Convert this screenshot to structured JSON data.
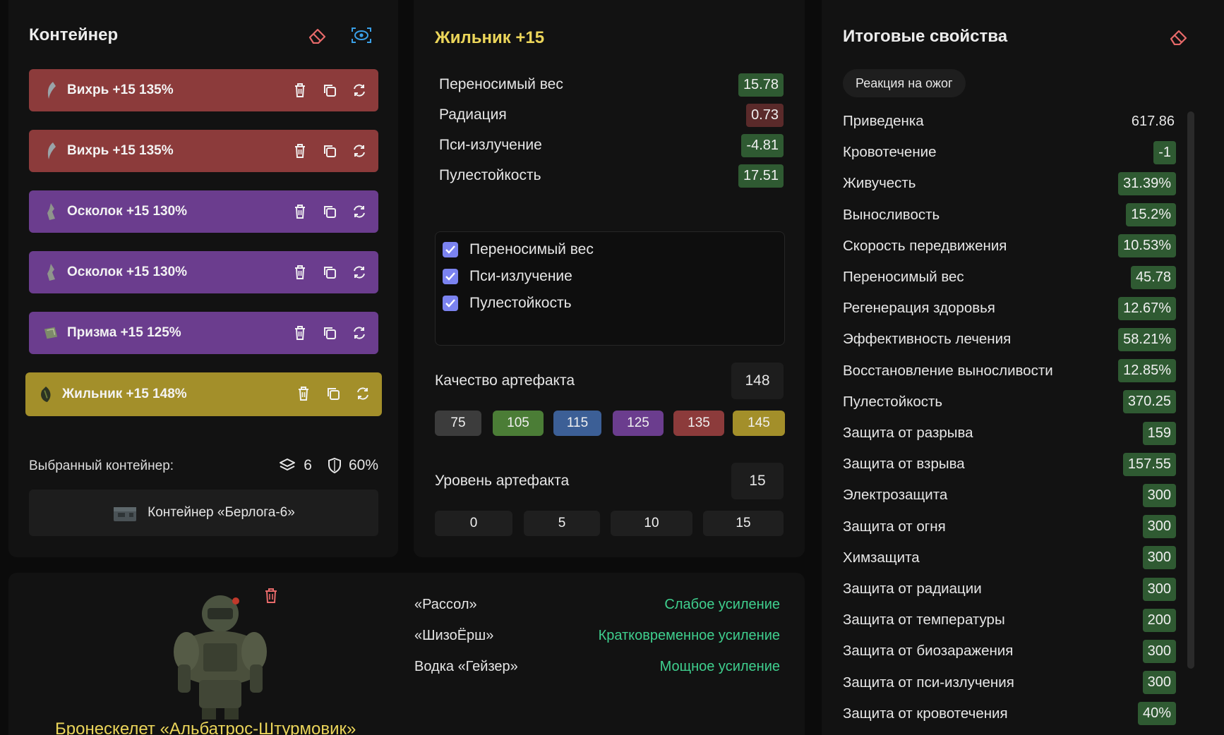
{
  "container_panel": {
    "title": "Контейнер",
    "artifacts": [
      {
        "name": "Вихрь  +15 135%",
        "color": "#8c3b3b"
      },
      {
        "name": "Вихрь  +15 135%",
        "color": "#8c3b3b"
      },
      {
        "name": "Осколок  +15 130%",
        "color": "#6b3d8e"
      },
      {
        "name": "Осколок  +15 130%",
        "color": "#6b3d8e"
      },
      {
        "name": "Призма  +15 125%",
        "color": "#6b3d8e"
      },
      {
        "name": "Жильник  +15 148%",
        "color": "#a38f2a"
      }
    ],
    "selected_label": "Выбранный контейнер:",
    "slots": "6",
    "protection": "60%",
    "container_name": "Контейнер «Берлога-6»"
  },
  "artifact_panel": {
    "title": "Жильник +15",
    "properties": [
      {
        "name": "Переносимый вес",
        "value": "15.78",
        "tone": "good"
      },
      {
        "name": "Радиация",
        "value": "0.73",
        "tone": "bad"
      },
      {
        "name": "Пси-излучение",
        "value": "-4.81",
        "tone": "good"
      },
      {
        "name": "Пулестойкость",
        "value": "17.51",
        "tone": "good"
      }
    ],
    "checks": [
      {
        "label": "Переносимый вес",
        "checked": true
      },
      {
        "label": "Пси-излучение",
        "checked": true
      },
      {
        "label": "Пулестойкость",
        "checked": true
      }
    ],
    "quality_label": "Качество артефакта",
    "quality_value": "148",
    "quality_presets": [
      "75",
      "105",
      "115",
      "125",
      "135",
      "145"
    ],
    "level_label": "Уровень артефакта",
    "level_value": "15",
    "level_presets": [
      "0",
      "5",
      "10",
      "15"
    ]
  },
  "totals_panel": {
    "title": "Итоговые свойства",
    "reaction_button": "Реакция на ожог",
    "rows": [
      {
        "name": "Приведенка",
        "value": "617.86",
        "tone": "plain"
      },
      {
        "name": "Кровотечение",
        "value": "-1",
        "tone": "good"
      },
      {
        "name": "Живучесть",
        "value": "31.39%",
        "tone": "good"
      },
      {
        "name": "Выносливость",
        "value": "15.2%",
        "tone": "good"
      },
      {
        "name": "Скорость передвижения",
        "value": "10.53%",
        "tone": "good"
      },
      {
        "name": "Переносимый вес",
        "value": "45.78",
        "tone": "good"
      },
      {
        "name": "Регенерация здоровья",
        "value": "12.67%",
        "tone": "good"
      },
      {
        "name": "Эффективность лечения",
        "value": "58.21%",
        "tone": "good"
      },
      {
        "name": "Восстановление выносливости",
        "value": "12.85%",
        "tone": "good"
      },
      {
        "name": "Пулестойкость",
        "value": "370.25",
        "tone": "good"
      },
      {
        "name": "Защита от разрыва",
        "value": "159",
        "tone": "good"
      },
      {
        "name": "Защита от взрыва",
        "value": "157.55",
        "tone": "good"
      },
      {
        "name": "Электрозащита",
        "value": "300",
        "tone": "good"
      },
      {
        "name": "Защита от огня",
        "value": "300",
        "tone": "good"
      },
      {
        "name": "Химзащита",
        "value": "300",
        "tone": "good"
      },
      {
        "name": "Защита от радиации",
        "value": "300",
        "tone": "good"
      },
      {
        "name": "Защита от температуры",
        "value": "200",
        "tone": "good"
      },
      {
        "name": "Защита от биозаражения",
        "value": "300",
        "tone": "good"
      },
      {
        "name": "Защита от пси-излучения",
        "value": "300",
        "tone": "good"
      },
      {
        "name": "Защита от кровотечения",
        "value": "40%",
        "tone": "good"
      }
    ]
  },
  "armor_panel": {
    "name": "Бронескелет «Альбатрос-Штурмовик»",
    "boosts": [
      {
        "name": "«Рассол»",
        "effect": "Слабое усиление"
      },
      {
        "name": "«ШизоЁрш»",
        "effect": "Кратковременное усиление"
      },
      {
        "name": "Водка «Гейзер»",
        "effect": "Мощное усиление"
      }
    ]
  },
  "colors": {
    "accent_yellow": "#ebd55a",
    "good_badge": "#2f5a32",
    "bad_badge": "#5a2a2a",
    "effect_green": "#3fcf8e",
    "checkbox": "#7b83f0",
    "eraser_icon": "#e86a6a",
    "eye_icon": "#3aa0e8"
  }
}
